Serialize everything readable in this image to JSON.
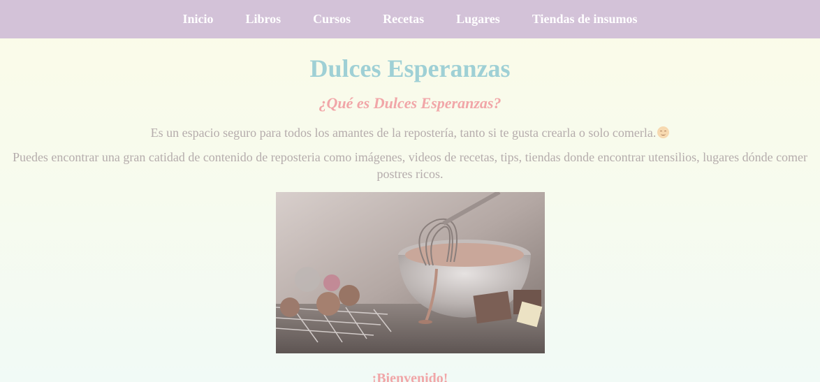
{
  "nav": {
    "items": [
      {
        "label": "Inicio"
      },
      {
        "label": "Libros"
      },
      {
        "label": "Cursos"
      },
      {
        "label": "Recetas"
      },
      {
        "label": "Lugares"
      },
      {
        "label": "Tiendas de insumos"
      }
    ]
  },
  "main": {
    "title": "Dulces Esperanzas",
    "subtitle_prefix": "¿Qué es ",
    "subtitle_em": "Dulces Esperanzas?",
    "paragraph1": "Es un espacio seguro para todos los amantes de la repostería, tanto si te gusta crearla o solo comerla.",
    "paragraph2": "Puedes encontrar una gran catidad de contenido de reposteria como imágenes, videos de recetas, tips, tiendas donde encontrar utensilios, lugares dónde comer postres ricos.",
    "welcome": "¡Bienvenido!"
  },
  "icons": {
    "emoji": "smiling-face-icon"
  },
  "colors": {
    "navbar_bg": "#d3c2d8",
    "title": "#9fd0d5",
    "accent_pink": "#f1a6a8",
    "body_text": "#b5acac"
  }
}
